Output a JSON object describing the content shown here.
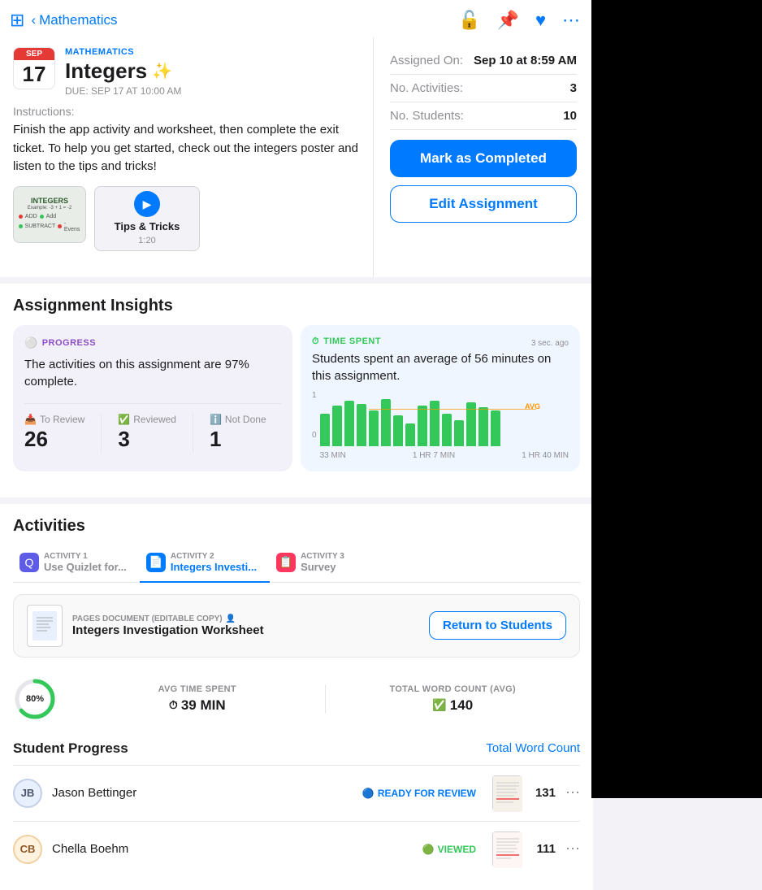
{
  "nav": {
    "back_label": "Mathematics",
    "sidebar_icon": "⊞",
    "icons": [
      "🔓",
      "📌",
      "♥",
      "⋯"
    ]
  },
  "assignment": {
    "subject": "Mathematics",
    "title": "Integers",
    "sparkle": "✨",
    "due_date": "DUE: SEP 17 AT 10:00 AM",
    "calendar": {
      "month": "SEP",
      "day": "17"
    },
    "instructions_label": "Instructions:",
    "instructions_text": "Finish the app activity and worksheet, then complete the exit ticket. To help you get started, check out the integers poster and listen to the tips and tricks!",
    "attachments": [
      {
        "type": "image",
        "label": "INTEGERS"
      },
      {
        "type": "video",
        "title": "Tips & Tricks",
        "duration": "1:20"
      }
    ]
  },
  "meta": {
    "assigned_on_label": "Assigned On:",
    "assigned_on_value": "Sep 10 at 8:59 AM",
    "activities_label": "No. Activities:",
    "activities_value": "3",
    "students_label": "No. Students:",
    "students_value": "10"
  },
  "buttons": {
    "mark_completed": "Mark as Completed",
    "edit_assignment": "Edit Assignment"
  },
  "insights": {
    "title": "Assignment Insights",
    "progress": {
      "category": "PROGRESS",
      "text": "The activities on this assignment are 97% complete."
    },
    "time_spent": {
      "category": "TIME SPENT",
      "time_ago": "3 sec. ago",
      "text": "Students spent an average of 56 minutes on this assignment."
    },
    "stats": {
      "to_review": {
        "label": "To Review",
        "value": "26"
      },
      "reviewed": {
        "label": "Reviewed",
        "value": "3"
      },
      "not_done": {
        "label": "Not Done",
        "value": "1"
      }
    },
    "chart": {
      "y_max": "1",
      "y_min": "0",
      "x_labels": [
        "33 MIN",
        "1 HR 7 MIN",
        "1 HR 40 MIN"
      ],
      "avg_label": "AVG",
      "bars": [
        40,
        55,
        60,
        58,
        50,
        62,
        45,
        30,
        55,
        60,
        42,
        35,
        58,
        52,
        48
      ]
    }
  },
  "activities": {
    "title": "Activities",
    "tabs": [
      {
        "num": "ACTIVITY 1",
        "label": "Use Quizlet for...",
        "active": false,
        "icon_type": "purple",
        "icon": "Q"
      },
      {
        "num": "ACTIVITY 2",
        "label": "Integers Investi...",
        "active": true,
        "icon_type": "blue",
        "icon": "📄"
      },
      {
        "num": "ACTIVITY 3",
        "label": "Survey",
        "active": false,
        "icon_type": "pink",
        "icon": "📋"
      }
    ],
    "document": {
      "type": "PAGES DOCUMENT (EDITABLE COPY)",
      "name": "Integers Investigation Worksheet",
      "return_btn": "Return to Students"
    },
    "metrics": {
      "completion": "80%",
      "avg_time_label": "AVG TIME SPENT",
      "avg_time_value": "39 MIN",
      "word_count_label": "TOTAL WORD COUNT (AVG)",
      "word_count_value": "140"
    },
    "student_progress": {
      "title": "Student Progress",
      "link": "Total Word Count",
      "students": [
        {
          "initials": "JB",
          "name": "Jason Bettinger",
          "status": "READY FOR REVIEW",
          "status_type": "review",
          "word_count": "131"
        },
        {
          "initials": "CB",
          "name": "Chella Boehm",
          "status": "VIEWED",
          "status_type": "viewed",
          "word_count": "111"
        }
      ]
    }
  }
}
